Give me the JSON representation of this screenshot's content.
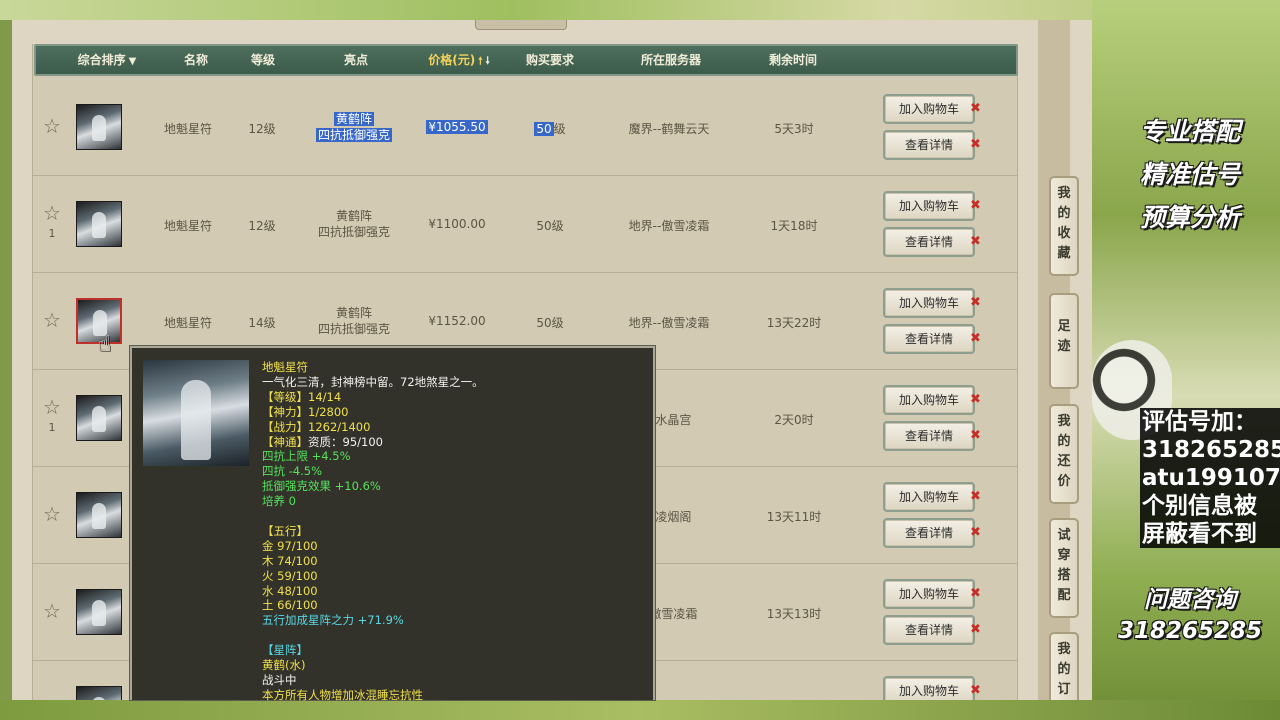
{
  "columns": {
    "sort": "综合排序",
    "name": "名称",
    "level": "等级",
    "highlight": "亮点",
    "price": "价格(元)",
    "requirement": "购买要求",
    "server": "所在服务器",
    "time_left": "剩余时间"
  },
  "rows": [
    {
      "fav_count": "",
      "name": "地魁星符",
      "level": "12级",
      "highlight_1": "黄鹤阵",
      "highlight_2": "四抗抵御强克",
      "price": "¥1055.50",
      "req_num": "50",
      "req_unit": "级",
      "server": "魔界--鹤舞云天",
      "time_left": "5天3时"
    },
    {
      "fav_count": "1",
      "name": "地魁星符",
      "level": "12级",
      "highlight_1": "黄鹤阵",
      "highlight_2": "四抗抵御强克",
      "price": "¥1100.00",
      "req_num": "50级",
      "req_unit": "",
      "server": "地界--傲雪凌霜",
      "time_left": "1天18时"
    },
    {
      "fav_count": "",
      "name": "地魁星符",
      "level": "14级",
      "highlight_1": "黄鹤阵",
      "highlight_2": "四抗抵御强克",
      "price": "¥1152.00",
      "req_num": "50级",
      "req_unit": "",
      "server": "地界--傲雪凌霜",
      "time_left": "13天22时"
    },
    {
      "fav_count": "1",
      "server": "--水晶宫",
      "time_left": "2天0时"
    },
    {
      "fav_count": "",
      "server": "--凌烟阁",
      "time_left": "13天11时"
    },
    {
      "fav_count": "",
      "server": "--傲雪凌霜",
      "time_left": "13天13时"
    },
    {
      "fav_count": ""
    }
  ],
  "buttons": {
    "add_cart": "加入购物车",
    "view_detail": "查看详情",
    "remove": "✖"
  },
  "side_tabs": [
    {
      "label": "我的收藏"
    },
    {
      "label": "足迹"
    },
    {
      "label": "我的还价"
    },
    {
      "label": "试穿搭配"
    },
    {
      "label": "我的订"
    }
  ],
  "tooltip": {
    "title": "地魁星符",
    "desc": "一气化三清，封神榜中留。72地煞星之一。",
    "level": "【等级】14/14",
    "shenli": "【神力】1/2800",
    "zhanli": "【战力】1262/1400",
    "shentong_label": "【神通】",
    "shentong_value": "资质：95/100",
    "bonus_1": "四抗上限 +4.5%",
    "bonus_2": "四抗 -4.5%",
    "bonus_3": "抵御强克效果 +10.6%",
    "peiyang": "培养 0",
    "wuxing_header": "【五行】",
    "jin": "金 97/100",
    "mu": "木 74/100",
    "huo": "火 59/100",
    "shui": "水 48/100",
    "tu": "土 66/100",
    "wuxing_bonus": "五行加成星阵之力 +71.9%",
    "xingzhen_header": "【星阵】",
    "xingzhen_name": "黄鹤(水)",
    "status": "战斗中",
    "effect": "本方所有人物增加冰混睡忘抗性"
  },
  "overlay": {
    "promo_1": "专业搭配",
    "promo_2": "精准估号",
    "promo_3": "预算分析",
    "contact_1": "评估号加：",
    "contact_2": "318265285",
    "contact_3": "atu199107",
    "contact_4": "个别信息被",
    "contact_5": "屏蔽看不到",
    "consult_label": "问题咨询",
    "consult_number": "318265285"
  },
  "colors": {
    "header_bg": "#3c5b4b",
    "price_header": "#f4d25a",
    "selection": "#3667c9",
    "remove_x": "#c62f28",
    "tooltip_bg": "#33322a"
  }
}
